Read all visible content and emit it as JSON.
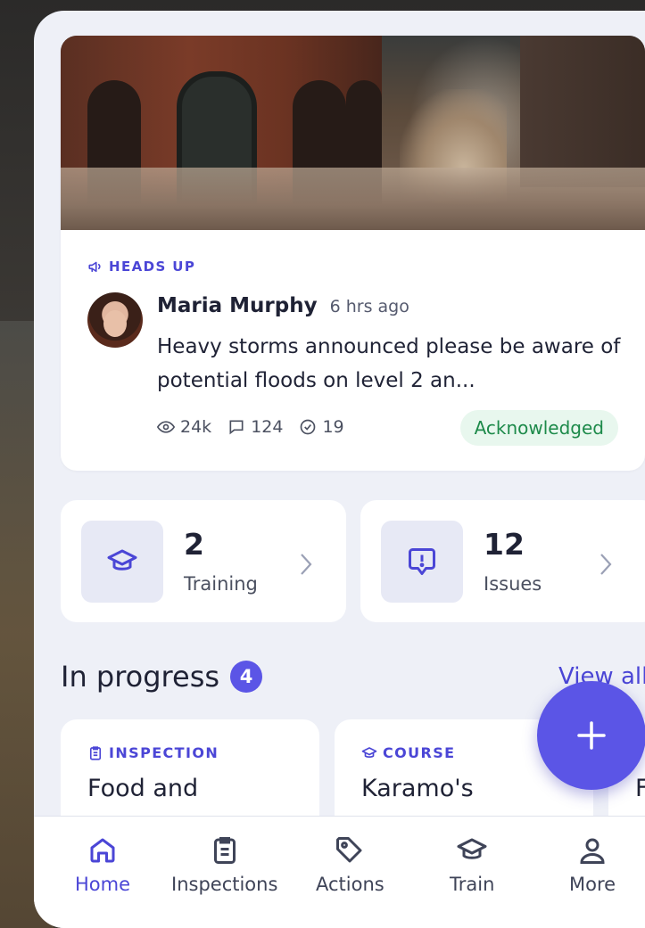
{
  "post": {
    "section_label": "HEADS UP",
    "author": "Maria Murphy",
    "time": "6 hrs ago",
    "message": "Heavy storms announced please be aware of potential floods on level 2 an...",
    "views": "24k",
    "comments": "124",
    "acknowledgements": "19",
    "status": "Acknowledged"
  },
  "tiles": [
    {
      "count": "2",
      "label": "Training",
      "icon": "graduation-cap-icon"
    },
    {
      "count": "12",
      "label": "Issues",
      "icon": "alert-message-icon"
    }
  ],
  "in_progress": {
    "title": "In progress",
    "count": "4",
    "view_all": "View all",
    "cards": [
      {
        "type": "INSPECTION",
        "name": "Food and"
      },
      {
        "type": "COURSE",
        "name": "Karamo's"
      },
      {
        "type": "",
        "name": "F"
      }
    ]
  },
  "fab_label": "+",
  "nav": [
    {
      "label": "Home",
      "icon": "home-icon",
      "active": true
    },
    {
      "label": "Inspections",
      "icon": "clipboard-icon",
      "active": false
    },
    {
      "label": "Actions",
      "icon": "tag-icon",
      "active": false
    },
    {
      "label": "Train",
      "icon": "graduation-cap-icon",
      "active": false
    },
    {
      "label": "More",
      "icon": "user-icon",
      "active": false
    }
  ],
  "colors": {
    "accent": "#5b55e6",
    "accent_text": "#4b46d6",
    "success_bg": "#e8f7ee",
    "success_text": "#1d8a4a",
    "background": "#eef0f7"
  }
}
